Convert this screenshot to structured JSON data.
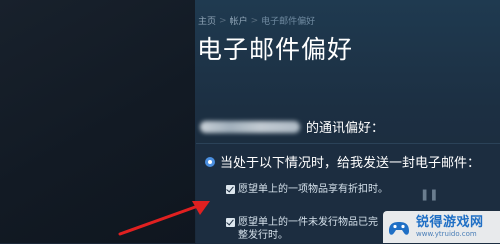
{
  "breadcrumb": {
    "home": "主页",
    "account": "帐户",
    "current": "电子邮件偏好",
    "separator": ">"
  },
  "page": {
    "title": "电子邮件偏好"
  },
  "preferences": {
    "suffix": "的通讯偏好："
  },
  "notify": {
    "radio_label": "当处于以下情况时，给我发送一封电子邮件：",
    "options": [
      {
        "label": "愿望单上的一项物品享有折扣时。",
        "checked": true
      },
      {
        "label": "愿望单上的一件未发行物品已完整发行时。",
        "checked": true
      }
    ]
  },
  "watermark": {
    "title": "锐得游戏网",
    "url": "www.ytruido.com"
  },
  "colors": {
    "accent": "#4b8fe0",
    "annotation_arrow": "#e02020",
    "background": "#1b2838"
  }
}
